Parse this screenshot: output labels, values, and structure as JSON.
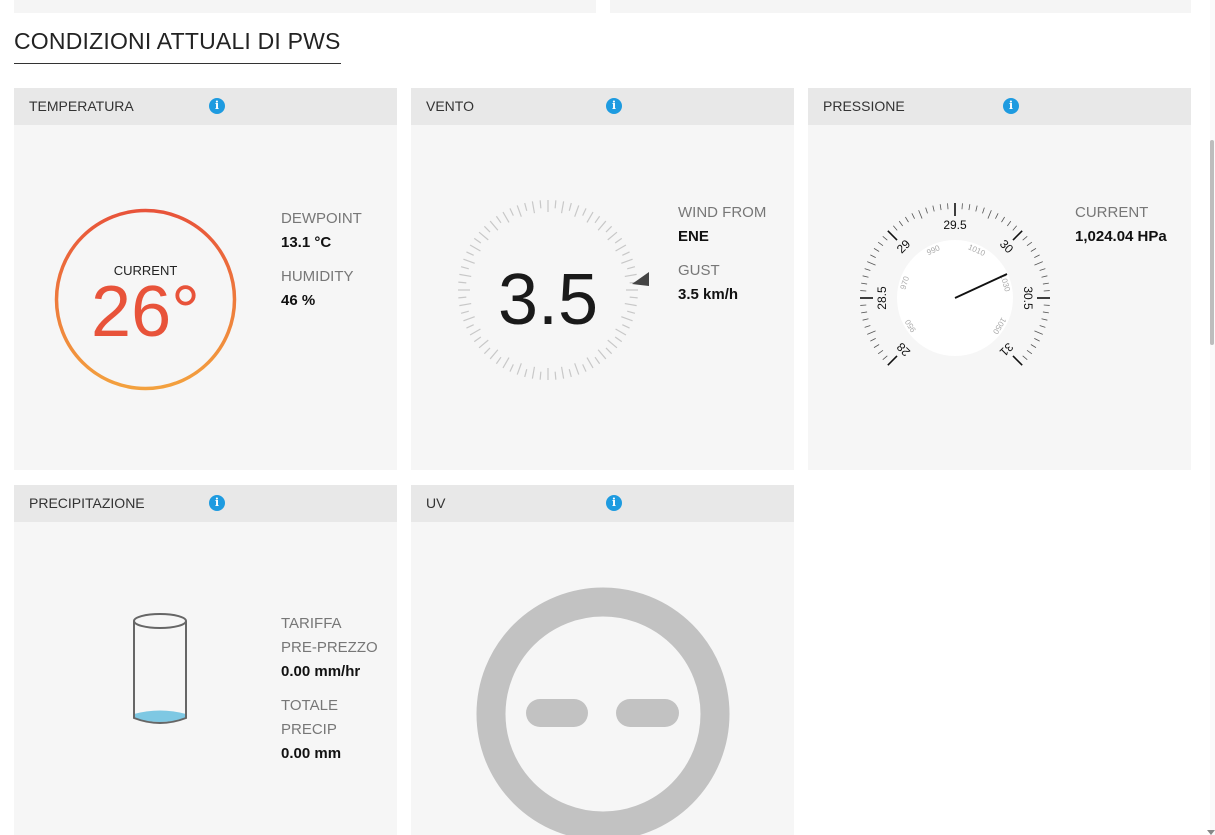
{
  "section": {
    "title": "CONDIZIONI ATTUALI DI PWS"
  },
  "temperature": {
    "title": "TEMPERATURA",
    "current_label": "CURRENT",
    "current_value": "26°",
    "dewpoint_label": "DEWPOINT",
    "dewpoint_value": "13.1 °C",
    "humidity_label": "HUMIDITY",
    "humidity_value": "46 %"
  },
  "wind": {
    "title": "VENTO",
    "speed": "3.5",
    "from_label": "WIND FROM",
    "from_value": "ENE",
    "gust_label": "GUST",
    "gust_value": "3.5 km/h"
  },
  "pressure": {
    "title": "PRESSIONE",
    "current_label": "CURRENT",
    "current_value": "1,024.04 HPa",
    "outer_scale": [
      "28",
      "28.5",
      "29",
      "29.5",
      "30",
      "30.5",
      "31"
    ],
    "inner_scale": [
      "950",
      "970",
      "990",
      "1010",
      "1030",
      "1050"
    ]
  },
  "precipitation": {
    "title": "PRECIPITAZIONE",
    "rate_label_1": "TARIFFA",
    "rate_label_2": "PRE-PREZZO",
    "rate_value": "0.00 mm/hr",
    "total_label_1": "TOTALE",
    "total_label_2": "PRECIP",
    "total_value": "0.00 mm"
  },
  "uv": {
    "title": "UV"
  },
  "colors": {
    "accent": "#1e9be0",
    "temp_ring_top": "#e8533a",
    "temp_ring_bottom": "#f3a13e",
    "temp_text": "#e8533a",
    "water": "#7ec8e3",
    "uv_gray": "#c2c2c2"
  },
  "icons": {
    "info": "info-icon",
    "wind_direction": "triangle-pointer-icon",
    "rain_gauge": "cylinder-gauge-icon",
    "uv_face": "uv-dash-icon"
  }
}
